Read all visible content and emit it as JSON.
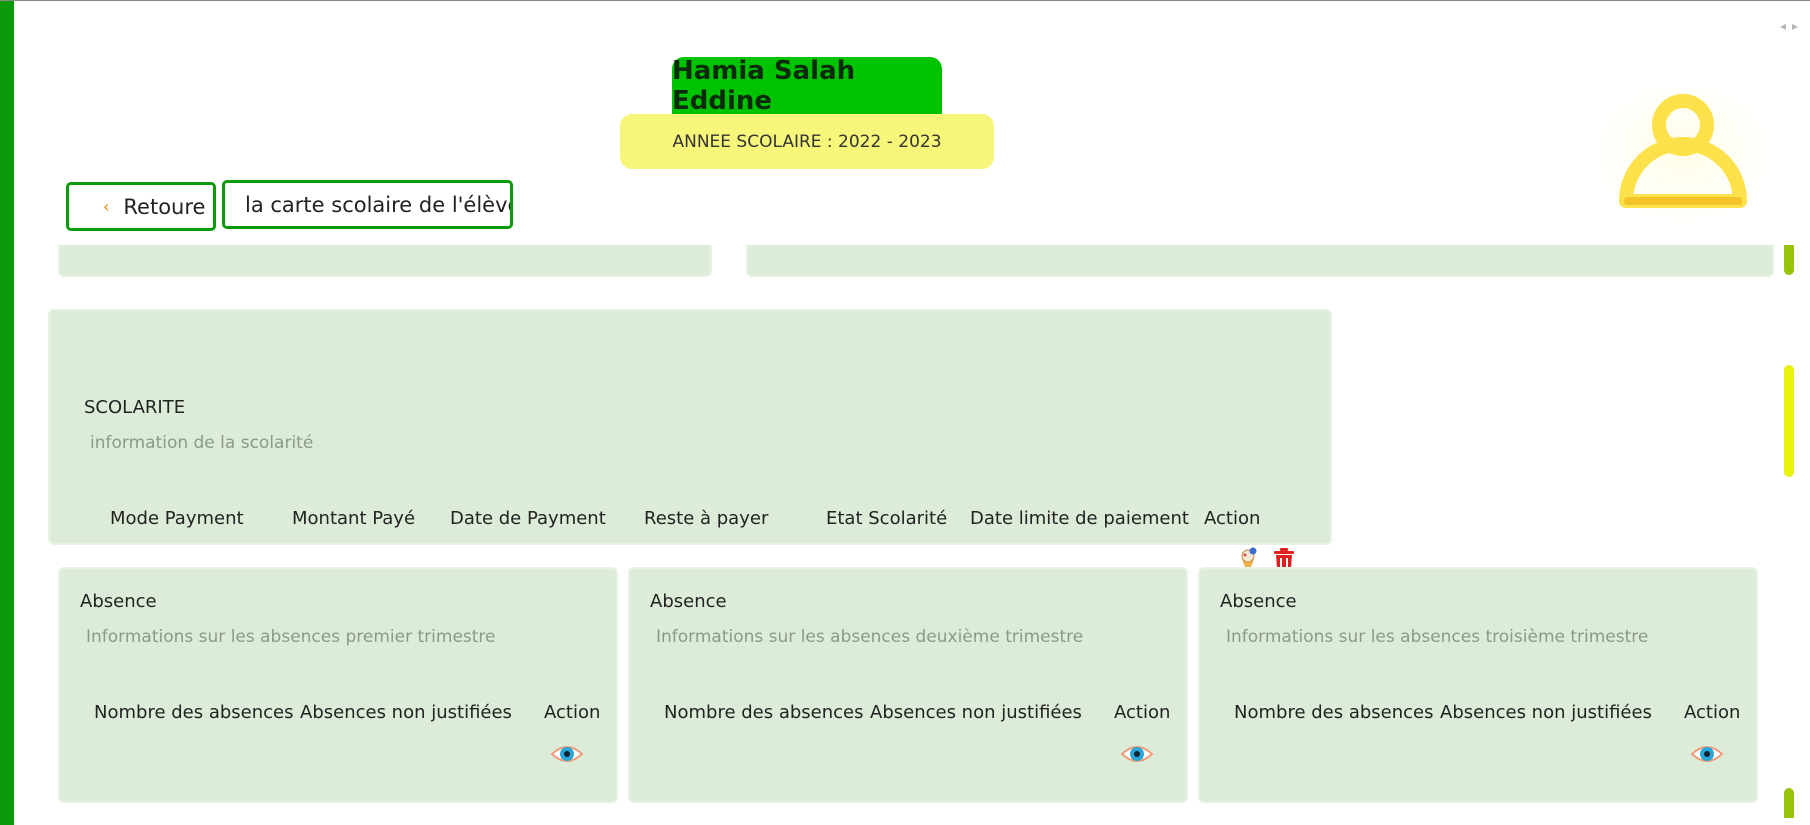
{
  "student": {
    "name": "Hamia Salah Eddine"
  },
  "school_year": {
    "label": "ANNEE SCOLAIRE : 2022 - 2023"
  },
  "toolbar": {
    "back_label": "Retoure",
    "card_label": "la carte scolaire de l'élève"
  },
  "scolarite": {
    "title": "SCOLARITE",
    "subtitle": "information de la scolarité",
    "columns": [
      "Mode Payment",
      "Montant Payé",
      "Date de Payment",
      "Reste à payer",
      "Etat Scolarité",
      "Date limite de paiement",
      "Action"
    ],
    "actions": [
      "receipt-icon",
      "trash-icon"
    ]
  },
  "absences": [
    {
      "title": "Absence",
      "subtitle": "Informations sur les absences premier trimestre",
      "columns": [
        "Nombre des absences",
        "Absences non justifiées",
        "Action"
      ]
    },
    {
      "title": "Absence",
      "subtitle": "Informations sur les absences deuxième trimestre",
      "columns": [
        "Nombre des absences",
        "Absences non justifiées",
        "Action"
      ]
    },
    {
      "title": "Absence",
      "subtitle": "Informations sur les absences troisième trimestre",
      "columns": [
        "Nombre des absences",
        "Absences non justifiées",
        "Action"
      ]
    }
  ],
  "colors": {
    "accent_green": "#0a9a0a",
    "name_green": "#00c300",
    "year_yellow": "#f6f77a",
    "panel_bg": "#ddecd8",
    "avatar_yellow": "#fde14a",
    "trash_red": "#e02020"
  }
}
